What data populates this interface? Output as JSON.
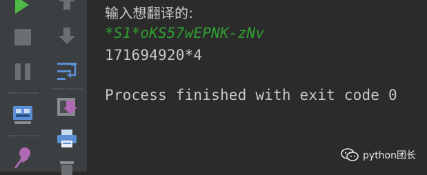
{
  "toolbar": {
    "left": [
      {
        "icon": "run-icon",
        "color": "#4fb848"
      },
      {
        "icon": "stop-icon"
      },
      {
        "icon": "pause-icon"
      },
      {
        "icon": "dump-threads-icon"
      },
      {
        "icon": "pin-icon"
      }
    ],
    "right": [
      {
        "icon": "up-arrow-icon"
      },
      {
        "icon": "down-arrow-icon"
      },
      {
        "icon": "soft-wrap-icon"
      },
      {
        "icon": "scroll-to-end-icon"
      },
      {
        "icon": "print-icon"
      },
      {
        "icon": "delete-icon"
      }
    ]
  },
  "console": {
    "lines": {
      "prompt": "输入想翻译的:",
      "user_input": "*S1*oKS57wEPNK-zNv",
      "output": "171694920*4",
      "blank": "",
      "exit": "Process finished with exit code 0"
    },
    "colors": {
      "text": "#c8c8c8",
      "input": "#2f9e2f"
    }
  },
  "watermark": {
    "label": "python团长"
  }
}
